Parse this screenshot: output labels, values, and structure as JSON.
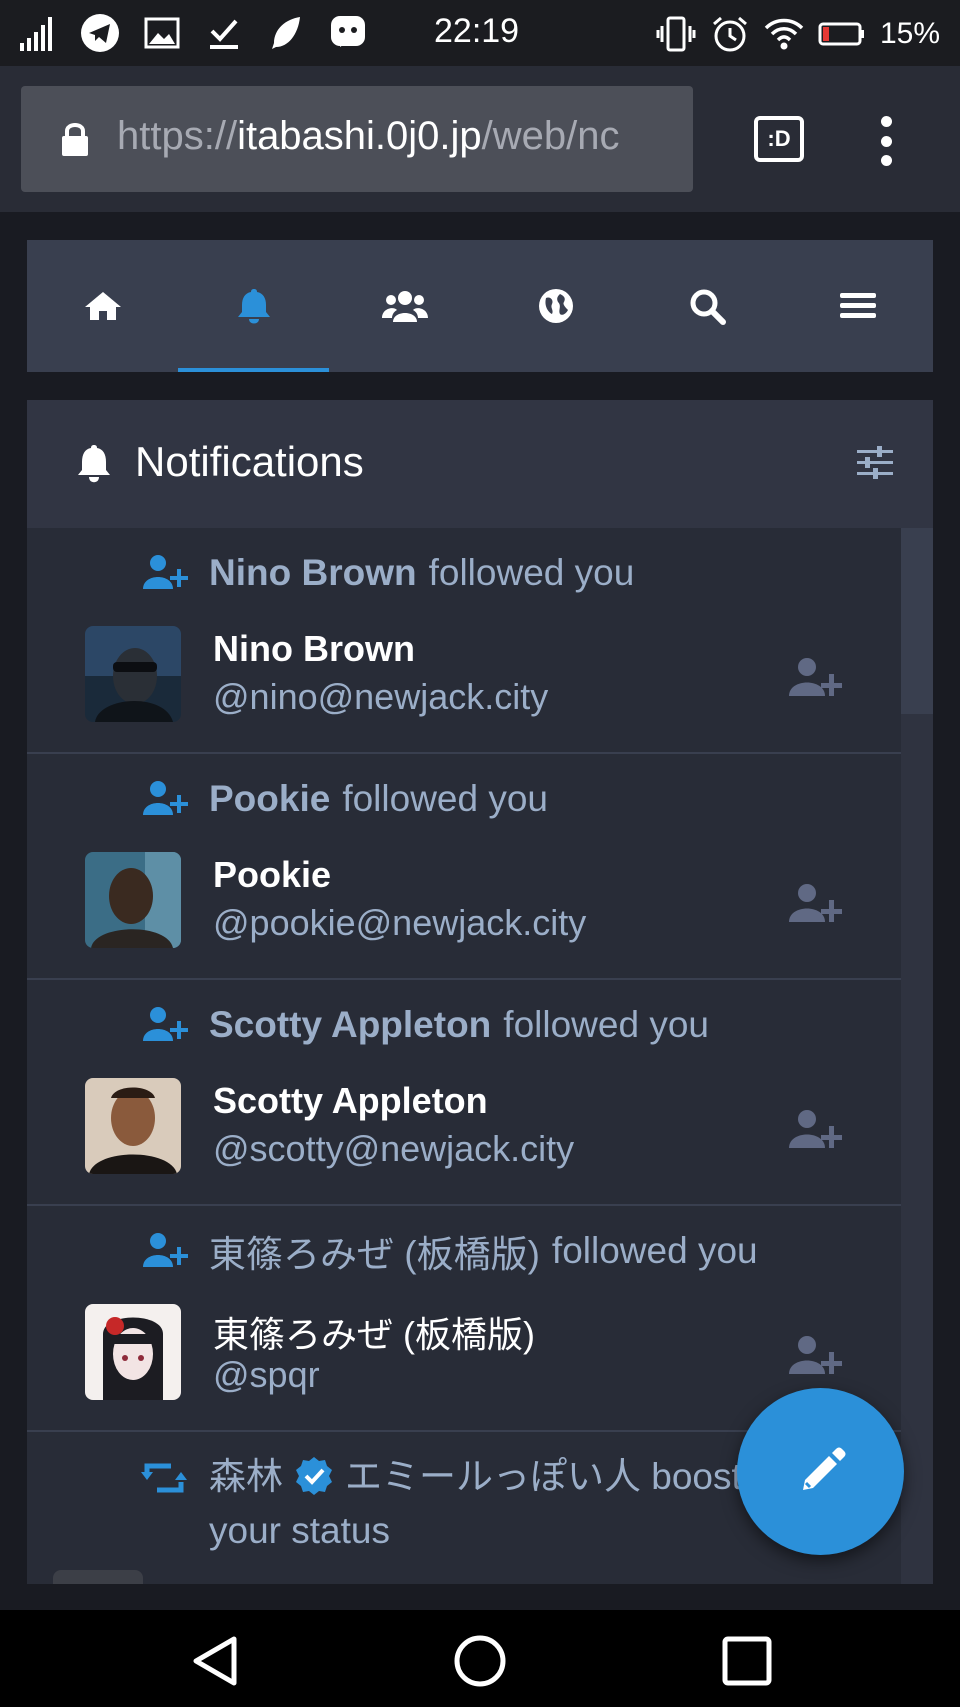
{
  "status_bar": {
    "time": "22:19",
    "battery_percent": "15%",
    "icons_left": [
      "signal-icon",
      "telegram-icon",
      "gallery-icon",
      "download-done-icon",
      "feather-icon",
      "mastodon-icon"
    ],
    "icons_right": [
      "vibrate-icon",
      "alarm-icon",
      "wifi-icon",
      "battery-icon"
    ]
  },
  "browser": {
    "url_scheme": "https://",
    "url_host": "itabashi.0j0.jp",
    "url_path": "/web/nc",
    "tab_button_label": ":D"
  },
  "nav_tabs": [
    {
      "icon": "home-icon",
      "active": false
    },
    {
      "icon": "bell-icon",
      "active": true
    },
    {
      "icon": "users-icon",
      "active": false
    },
    {
      "icon": "globe-icon",
      "active": false
    },
    {
      "icon": "search-icon",
      "active": false
    },
    {
      "icon": "menu-icon",
      "active": false
    }
  ],
  "column": {
    "title": "Notifications"
  },
  "notifications": [
    {
      "type": "follow",
      "name": "Nino Brown",
      "action": "followed you",
      "display_name": "Nino Brown",
      "acct": "@nino@newjack.city"
    },
    {
      "type": "follow",
      "name": "Pookie",
      "action": "followed you",
      "display_name": "Pookie",
      "acct": "@pookie@newjack.city"
    },
    {
      "type": "follow",
      "name": "Scotty Appleton",
      "action": "followed you",
      "display_name": "Scotty Appleton",
      "acct": "@scotty@newjack.city"
    },
    {
      "type": "follow",
      "name": "東篠ろみぜ (板橋版)",
      "action": "followed you",
      "display_name": "東篠ろみぜ (板橋版)",
      "acct": "@spqr"
    }
  ],
  "boost": {
    "name": "森林",
    "rest": "エミールっぽい人 boosted your status"
  },
  "colors": {
    "accent": "#2b90d9",
    "column_bg": "#282c37",
    "header_bg": "#313543",
    "nav_bg": "#393f4f",
    "muted_text": "#9baec8"
  }
}
